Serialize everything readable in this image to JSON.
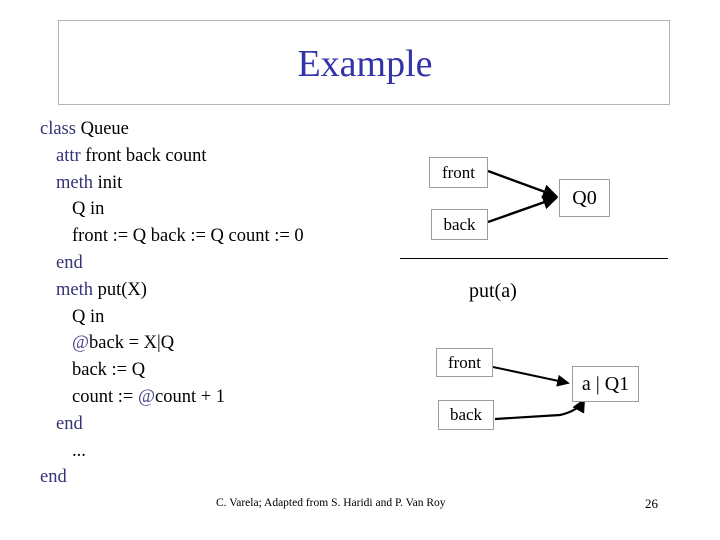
{
  "slide": {
    "title": "Example",
    "title_color": "#3333aa",
    "keyword_color": "#333377",
    "body_color": "#000000",
    "box_border_color": "#9d9d9d"
  },
  "code": {
    "lines": [
      {
        "indent": 0,
        "keyword": "class",
        "rest": " Queue"
      },
      {
        "indent": 1,
        "keyword": "attr",
        "rest": " front back count"
      },
      {
        "indent": 1,
        "keyword": "meth",
        "rest": " init"
      },
      {
        "indent": 2,
        "keyword": "",
        "rest": "Q in"
      },
      {
        "indent": 2,
        "keyword": "",
        "rest": "front := Q  back := Q  count := 0"
      },
      {
        "indent": 1,
        "keyword": "end",
        "rest": ""
      },
      {
        "indent": 1,
        "keyword": "meth",
        "rest": " put(X)"
      },
      {
        "indent": 2,
        "keyword": "",
        "rest": "Q in"
      },
      {
        "indent": 2,
        "keyword": "@",
        "rest": "back = X|Q",
        "at": true
      },
      {
        "indent": 2,
        "keyword": "",
        "rest": "back := Q"
      },
      {
        "indent": 2,
        "keyword": "",
        "rest": "count := ",
        "at_mid": "@",
        "rest2": "count + 1"
      },
      {
        "indent": 1,
        "keyword": "end",
        "rest": ""
      },
      {
        "indent": 2,
        "keyword": "",
        "rest": "..."
      },
      {
        "indent": 0,
        "keyword": "end",
        "rest": ""
      }
    ],
    "text_plain": [
      "class Queue",
      "  attr front back count",
      "  meth init",
      "    Q in",
      "    front := Q  back := Q  count := 0",
      "  end",
      "  meth put(X)",
      "    Q in",
      "    @back = X|Q",
      "    back := Q",
      "    count := @count + 1",
      "  end",
      "    ...",
      "end"
    ]
  },
  "diagram_top": {
    "front_label": "front",
    "back_label": "back",
    "target_label": "Q0"
  },
  "diagram_bottom": {
    "operation_label": "put(a)",
    "front_label": "front",
    "back_label": "back",
    "target_label": "a | Q1"
  },
  "footer": {
    "credit": "C. Varela; Adapted from S. Haridi and P. Van Roy",
    "page_number": "26"
  }
}
